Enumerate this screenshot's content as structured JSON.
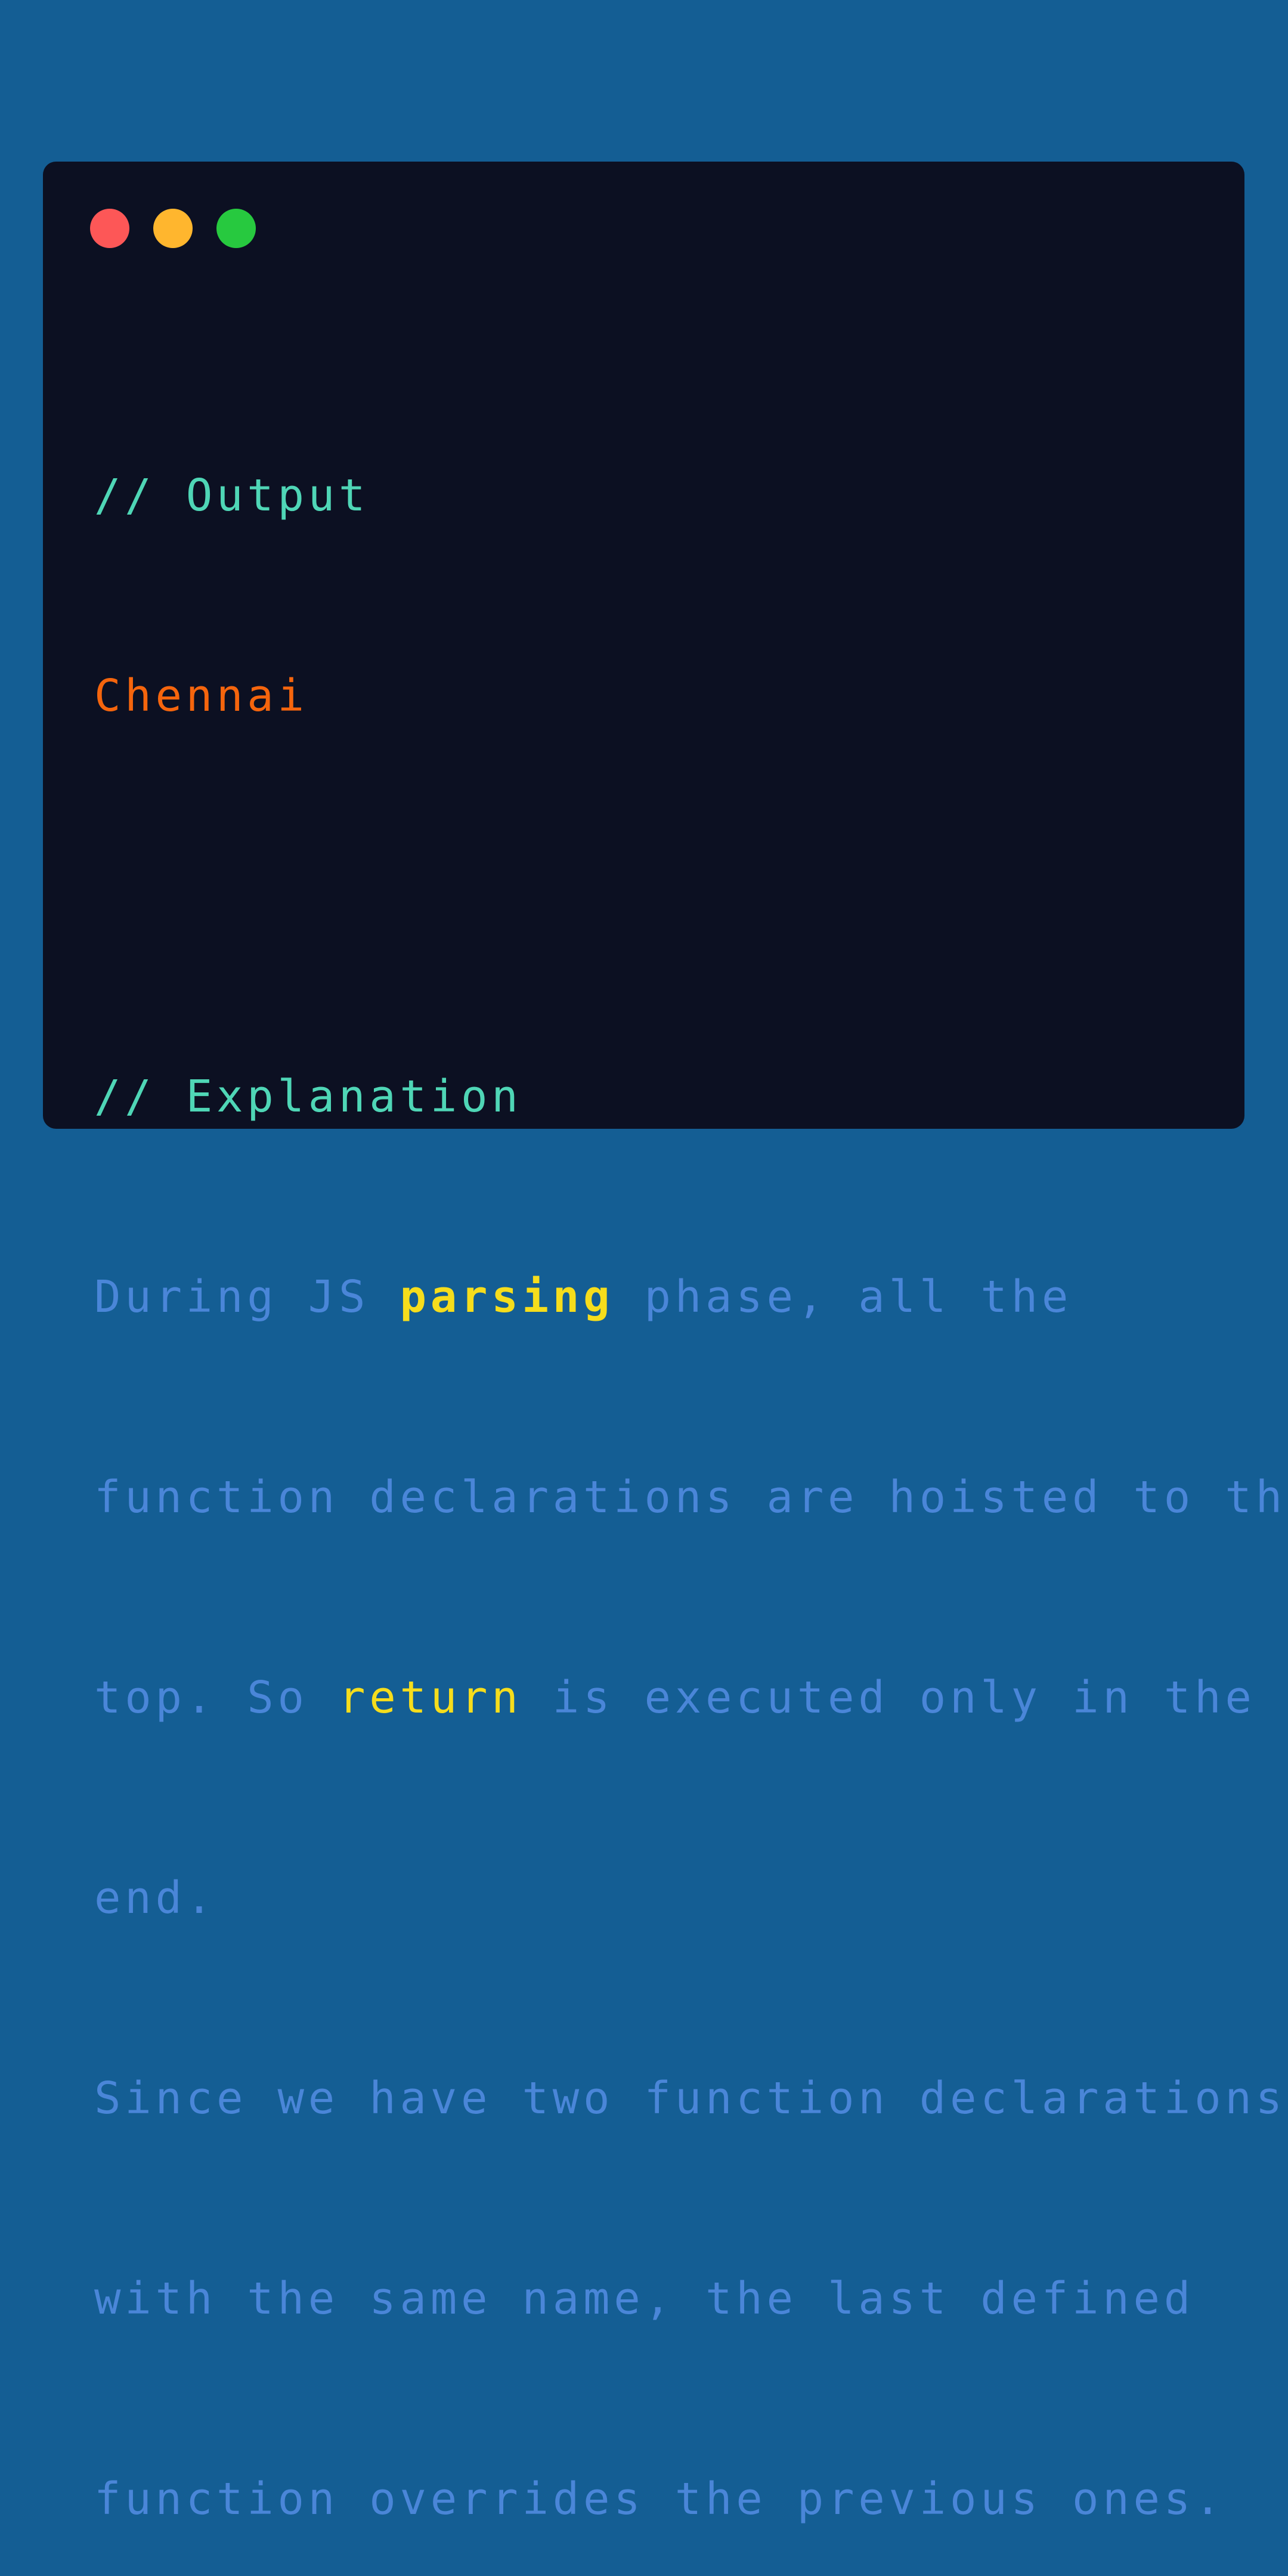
{
  "window": {
    "controls": [
      {
        "name": "close",
        "color": "#fd5757"
      },
      {
        "name": "minimize",
        "color": "#ffb62e"
      },
      {
        "name": "maximize",
        "color": "#27c93f"
      }
    ]
  },
  "code": {
    "output_comment": "// Output",
    "output_value": "Chennai",
    "explanation_comment": "// Explanation",
    "line1_a": "During JS ",
    "line1_kw": "parsing",
    "line1_b": " phase, all the",
    "line2": "function declarations are hoisted to the",
    "line3_a": "top. So ",
    "line3_kw": "return",
    "line3_b": " is executed only in the",
    "line4": "end.",
    "line5": "Since we have two function declarations",
    "line6": "with the same name, the last defined",
    "line7": "function overrides the previous ones."
  },
  "colors": {
    "background": "#145e94",
    "window": "#0c1022",
    "comment": "#4fd6b6",
    "output": "#f5650d",
    "text": "#4a86d8",
    "keyword": "#f6dd1c"
  }
}
